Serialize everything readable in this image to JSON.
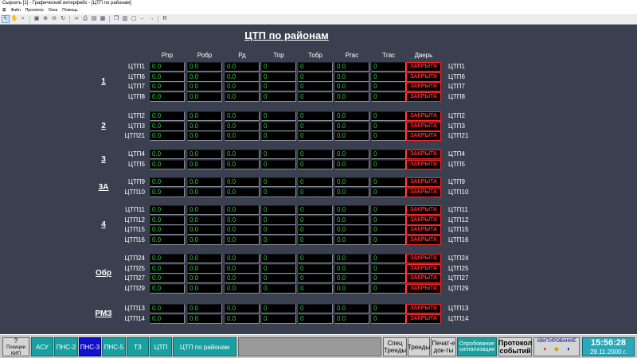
{
  "window": {
    "title": "Сырсеть [1] - Графический интерфейс - [ЦТП по районам]",
    "menu": [
      "Файл",
      "Просмотр",
      "Окна",
      "Помощь"
    ]
  },
  "toolbar": {
    "icons": [
      "select-icon",
      "hand-icon",
      "zoom-icon",
      "fit-icon",
      "zoom-in-icon",
      "zoom-out-icon",
      "refresh-icon",
      "binoculars-icon",
      "print-icon",
      "lock-icon",
      "open-icon",
      "copy-icon",
      "paste-icon",
      "window-icon",
      "back-icon",
      "forward-icon"
    ],
    "r_label": "R"
  },
  "page": {
    "title": "ЦТП по районам",
    "columns": [
      "Рпр",
      "Робр",
      "Рд",
      "Тпр",
      "Тобр",
      "Ргвс",
      "Тгвс",
      "Дверь"
    ]
  },
  "districts": [
    {
      "label": "1",
      "rows": [
        {
          "name": "ЦТП1",
          "values": [
            "0.0",
            "0.0",
            "0.0",
            "0",
            "0",
            "0.0",
            "0"
          ],
          "door": "ЗАКРЫТА"
        },
        {
          "name": "ЦТП6",
          "values": [
            "0.0",
            "0.0",
            "0.0",
            "0",
            "0",
            "0.0",
            "0"
          ],
          "door": "ЗАКРЫТА"
        },
        {
          "name": "ЦТП7",
          "values": [
            "0.0",
            "0.0",
            "0.0",
            "0",
            "0",
            "0.0",
            "0"
          ],
          "door": "ЗАКРЫТА"
        },
        {
          "name": "ЦТП8",
          "values": [
            "0.0",
            "0.0",
            "0.0",
            "0",
            "0",
            "0.0",
            "0"
          ],
          "door": "ЗАКРЫТА"
        }
      ]
    },
    {
      "label": "2",
      "rows": [
        {
          "name": "ЦТП2",
          "values": [
            "0.0",
            "0.0",
            "0.0",
            "0",
            "0",
            "0.0",
            "0"
          ],
          "door": "ЗАКРЫТА"
        },
        {
          "name": "ЦТП3",
          "values": [
            "0.0",
            "0.0",
            "0.0",
            "0",
            "0",
            "0.0",
            "0"
          ],
          "door": "ЗАКРЫТА"
        },
        {
          "name": "ЦТП21",
          "values": [
            "0.0",
            "0.0",
            "0.0",
            "0",
            "0",
            "0.0",
            "0"
          ],
          "door": "ЗАКРЫТА"
        }
      ]
    },
    {
      "label": "3",
      "rows": [
        {
          "name": "ЦТП4",
          "values": [
            "0.0",
            "0.0",
            "0.0",
            "0",
            "0",
            "0.0",
            "0"
          ],
          "door": "ЗАКРЫТА"
        },
        {
          "name": "ЦТП5",
          "values": [
            "0.0",
            "0.0",
            "0.0",
            "0",
            "0",
            "0.0",
            "0"
          ],
          "door": "ЗАКРЫТА"
        }
      ]
    },
    {
      "label": "3А",
      "rows": [
        {
          "name": "ЦТП9",
          "values": [
            "0.0",
            "0.0",
            "0.0",
            "0",
            "0",
            "0.0",
            "0"
          ],
          "door": "ЗАКРЫТА"
        },
        {
          "name": "ЦТП10",
          "values": [
            "0.0",
            "0.0",
            "0.0",
            "0",
            "0",
            "0.0",
            "0"
          ],
          "door": "ЗАКРЫТА"
        }
      ]
    },
    {
      "label": "4",
      "rows": [
        {
          "name": "ЦТП11",
          "values": [
            "0.0",
            "0.0",
            "0.0",
            "0",
            "0",
            "0.0",
            "0"
          ],
          "door": "ЗАКРЫТА"
        },
        {
          "name": "ЦТП12",
          "values": [
            "0.0",
            "0.0",
            "0.0",
            "0",
            "0",
            "0.0",
            "0"
          ],
          "door": "ЗАКРЫТА"
        },
        {
          "name": "ЦТП15",
          "values": [
            "0.0",
            "0.0",
            "0.0",
            "0",
            "0",
            "0.0",
            "0"
          ],
          "door": "ЗАКРЫТА"
        },
        {
          "name": "ЦТП16",
          "values": [
            "0.0",
            "0.0",
            "0.0",
            "0",
            "0",
            "0.0",
            "0"
          ],
          "door": "ЗАКРЫТА"
        }
      ]
    },
    {
      "label": "Обр",
      "rows": [
        {
          "name": "ЦТП24",
          "values": [
            "0.0",
            "0.0",
            "0.0",
            "0",
            "0",
            "0.0",
            "0"
          ],
          "door": "ЗАКРЫТА"
        },
        {
          "name": "ЦТП25",
          "values": [
            "0.0",
            "0.0",
            "0.0",
            "0",
            "0",
            "0.0",
            "0"
          ],
          "door": "ЗАКРЫТА"
        },
        {
          "name": "ЦТП27",
          "values": [
            "0.0",
            "0.0",
            "0.0",
            "0",
            "0",
            "0.0",
            "0"
          ],
          "door": "ЗАКРЫТА"
        },
        {
          "name": "ЦТП29",
          "values": [
            "0.0",
            "0.0",
            "0.0",
            "0",
            "0",
            "0.0",
            "0"
          ],
          "door": "ЗАКРЫТА"
        }
      ]
    },
    {
      "label": "РМЗ",
      "rows": [
        {
          "name": "ЦТП13",
          "values": [
            "0.0",
            "0.0",
            "0.0",
            "0",
            "0",
            "0.0",
            "0"
          ],
          "door": "ЗАКРЫТА"
        },
        {
          "name": "ЦТП14",
          "values": [
            "0.0",
            "0.0",
            "0.0",
            "0",
            "0",
            "0.0",
            "0"
          ],
          "door": "ЗАКРЫТА"
        }
      ]
    }
  ],
  "taskbar": {
    "positions_label": "?",
    "positions_sub": "Позиции КИП",
    "tabs": [
      "АСУ",
      "ПНС-2",
      "ПНС-3",
      "ПНС-5",
      "ТЗ",
      "ЦТП",
      "ЦТП по районам"
    ],
    "active_tab": "ПНС-3",
    "spec_trends": "Спец Тренды",
    "trends": "Тренды",
    "print_docs": "Печат-е док-ты",
    "signal_poll": "Опробование сигнализации",
    "event_log": "Протокол событий",
    "ack_label": "КВИТИРОВАНИЕ",
    "time": "15:56:28",
    "date": "29.11.2000 г."
  },
  "colors": {
    "background": "#3b4050",
    "value_text": "#2ad13a",
    "door_alarm": "#ff2a2a",
    "tab_teal": "#1aa0a0",
    "tab_active": "#1111cc"
  }
}
